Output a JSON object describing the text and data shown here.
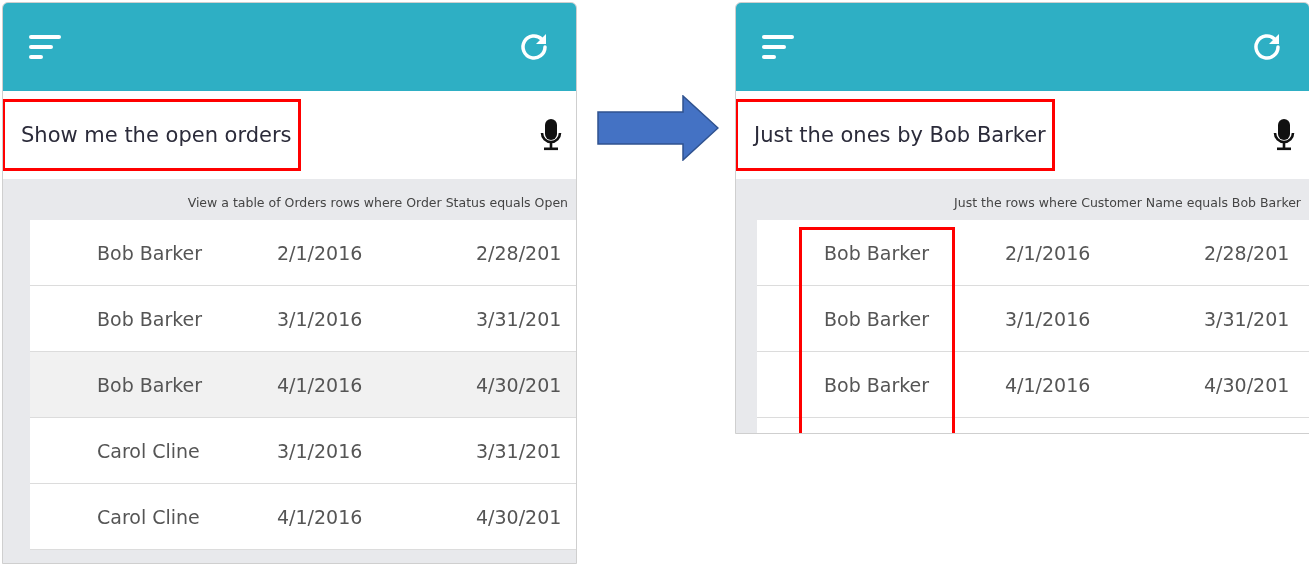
{
  "panels": [
    {
      "query": {
        "text": "Show me the open orders",
        "highlighted": true
      },
      "caption": "View a table of Orders rows where Order Status equals Open",
      "name_column_highlighted": false,
      "rows": [
        {
          "customer": "Bob Barker",
          "start_date": "2/1/2016",
          "end_date": "2/28/201",
          "shaded": false
        },
        {
          "customer": "Bob Barker",
          "start_date": "3/1/2016",
          "end_date": "3/31/201",
          "shaded": false
        },
        {
          "customer": "Bob Barker",
          "start_date": "4/1/2016",
          "end_date": "4/30/201",
          "shaded": true
        },
        {
          "customer": "Carol Cline",
          "start_date": "3/1/2016",
          "end_date": "3/31/201",
          "shaded": false
        },
        {
          "customer": "Carol Cline",
          "start_date": "4/1/2016",
          "end_date": "4/30/201",
          "shaded": false
        }
      ]
    },
    {
      "query": {
        "text": "Just the ones by Bob Barker",
        "highlighted": true
      },
      "caption": "Just the rows where Customer Name equals Bob Barker",
      "name_column_highlighted": true,
      "rows": [
        {
          "customer": "Bob Barker",
          "start_date": "2/1/2016",
          "end_date": "2/28/201",
          "shaded": false
        },
        {
          "customer": "Bob Barker",
          "start_date": "3/1/2016",
          "end_date": "3/31/201",
          "shaded": false
        },
        {
          "customer": "Bob Barker",
          "start_date": "4/1/2016",
          "end_date": "4/30/201",
          "shaded": false
        }
      ]
    }
  ]
}
